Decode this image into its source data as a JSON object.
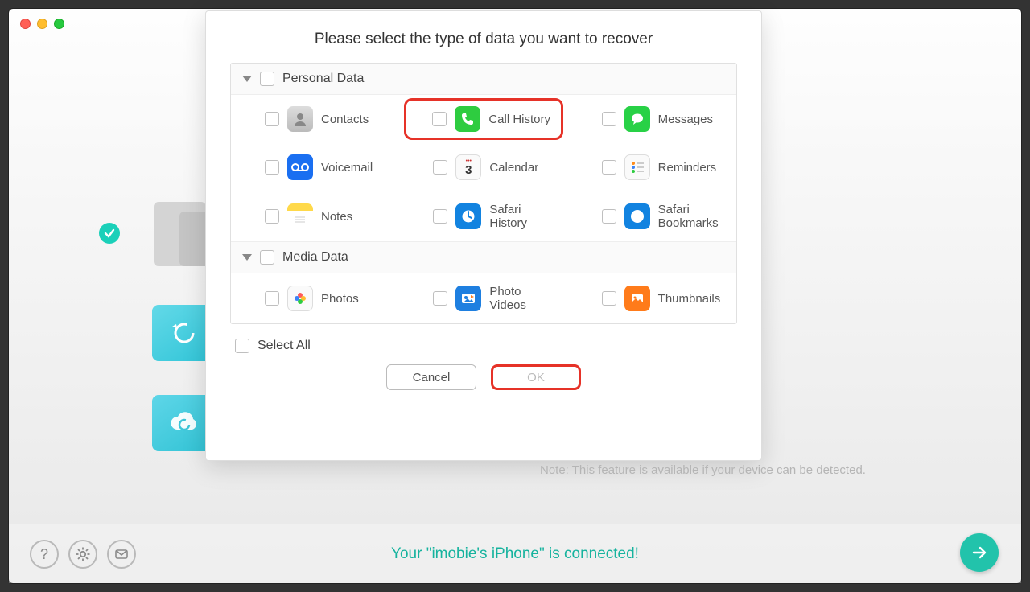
{
  "modal": {
    "title": "Please select the type of data you want to recover",
    "sections": {
      "personal": {
        "label": "Personal Data"
      },
      "media": {
        "label": "Media Data"
      }
    },
    "items": {
      "contacts": "Contacts",
      "call_history": "Call History",
      "messages": "Messages",
      "voicemail": "Voicemail",
      "calendar": "Calendar",
      "reminders": "Reminders",
      "notes": "Notes",
      "safari_history": "Safari History",
      "safari_bookmarks": "Safari Bookmarks",
      "photos": "Photos",
      "photo_videos": "Photo Videos",
      "thumbnails": "Thumbnails"
    },
    "select_all": "Select All",
    "cancel": "Cancel",
    "ok": "OK"
  },
  "note": "Note: This feature is available if your device can be detected.",
  "footer": {
    "status": "Your \"imobie's iPhone\" is connected!"
  },
  "calendar_day": "3"
}
